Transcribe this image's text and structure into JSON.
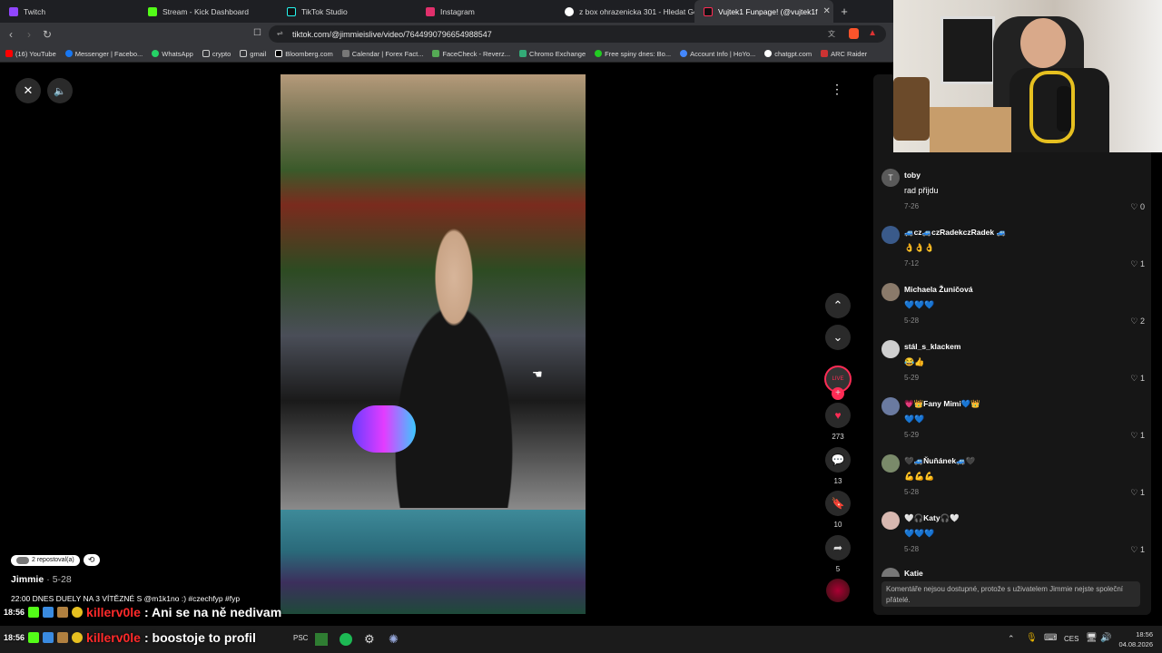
{
  "tabs": [
    {
      "label": "Twitch",
      "color": "#9146ff"
    },
    {
      "label": "Stream - Kick Dashboard",
      "color": "#53fc18"
    },
    {
      "label": "TikTok Studio",
      "color": "#111111"
    },
    {
      "label": "Instagram",
      "color": "#e1306c"
    },
    {
      "label": "z box ohrazenicka 301 - Hledat Goog",
      "color": "#ffffff"
    },
    {
      "label": "Vujtek1 Funpage! (@vujtek1f",
      "color": "#111111"
    }
  ],
  "address": {
    "url": "tiktok.com/@jimmieislive/video/7644990796654988547"
  },
  "bookmarks": [
    "(16) YouTube",
    "Messenger | Facebo...",
    "WhatsApp",
    "crypto",
    "gmail",
    "Bloomberg.com",
    "Calendar | Forex Fact...",
    "FaceCheck - Reverz...",
    "Chromo Exchange",
    "Free spiny dnes: Bo...",
    "Account Info | HoYo...",
    "chatgpt.com",
    "ARC Raider"
  ],
  "video": {
    "repost_label": "2 repostoval(a)",
    "author": "Jimmie",
    "date": "5-28",
    "caption": "22:00 DNES DUELY NA 3 VÍTĚZNÉ S @m1k1no :) #czechfyp #fyp",
    "likes": "273",
    "comments": "13",
    "saves": "10",
    "shares": "5"
  },
  "comments": [
    {
      "name": "toby",
      "text": "rad přijdu",
      "date": "7-26",
      "likes": "0",
      "avatar_letter": "T"
    },
    {
      "name": "🚙cz🚙czRadekczRadek 🚙",
      "text": "👌👌👌",
      "date": "7-12",
      "likes": "1"
    },
    {
      "name": "Michaela Žuničová",
      "text": "💙💙💙",
      "date": "5-28",
      "likes": "2"
    },
    {
      "name": "stál_s_klackem",
      "text": "😂👍",
      "date": "5-29",
      "likes": "1"
    },
    {
      "name": "💗👑Fany Mimi💙👑",
      "text": "💙💙",
      "date": "5-29",
      "likes": "1"
    },
    {
      "name": "🖤🚙Ňuňánek🚙🖤",
      "text": "💪💪💪",
      "date": "5-28",
      "likes": "1"
    },
    {
      "name": "🤍🎧Katy🎧🤍",
      "text": "💙💙💙",
      "date": "5-28",
      "likes": "1"
    },
    {
      "name": "Katie",
      "text": "",
      "date": "",
      "likes": ""
    }
  ],
  "comments_note": "Komentáře nejsou dostupné, protože s uživatelem Jimmie nejste společní přátelé.",
  "chat": [
    {
      "time": "18:56",
      "user": "killerv0le",
      "message": ": Ani se na ně nedivam"
    },
    {
      "time": "18:56",
      "user": "killerv0le",
      "message": ": boostoje to profil"
    }
  ],
  "taskbar": {
    "lang": "CES",
    "time": "18:56",
    "date": "04.08.2026"
  }
}
